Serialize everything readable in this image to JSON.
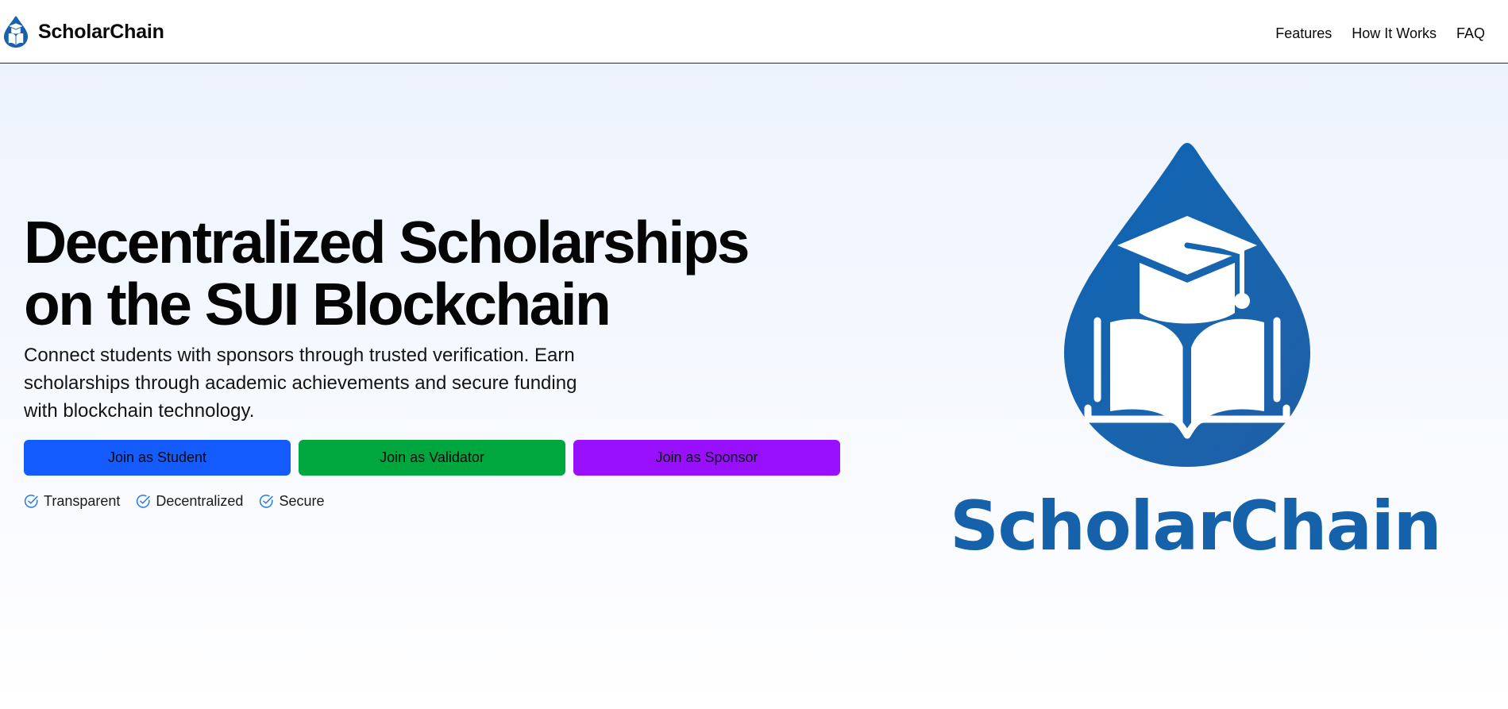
{
  "brand": {
    "name": "ScholarChain",
    "icon": "scholarchain-drop-logo-icon",
    "color": "#1562ab"
  },
  "nav": {
    "items": [
      {
        "label": "Features"
      },
      {
        "label": "How It Works"
      },
      {
        "label": "FAQ"
      }
    ]
  },
  "hero": {
    "title": "Decentralized Scholarships on the SUI Blockchain",
    "description": "Connect students with sponsors through trusted verification. Earn scholarships through academic achievements and secure funding with blockchain technology.",
    "buttons": [
      {
        "label": "Join as Student",
        "color": "#155cff"
      },
      {
        "label": "Join as Validator",
        "color": "#00a63e"
      },
      {
        "label": "Join as Sponsor",
        "color": "#9910ff"
      }
    ],
    "features": [
      {
        "label": "Transparent",
        "icon": "check-circle-icon"
      },
      {
        "label": "Decentralized",
        "icon": "check-circle-icon"
      },
      {
        "label": "Secure",
        "icon": "check-circle-icon"
      }
    ],
    "logo_wordmark": "ScholarChain"
  },
  "colors": {
    "accent": "#2a7be6",
    "hero_background": "#edf3fd"
  }
}
